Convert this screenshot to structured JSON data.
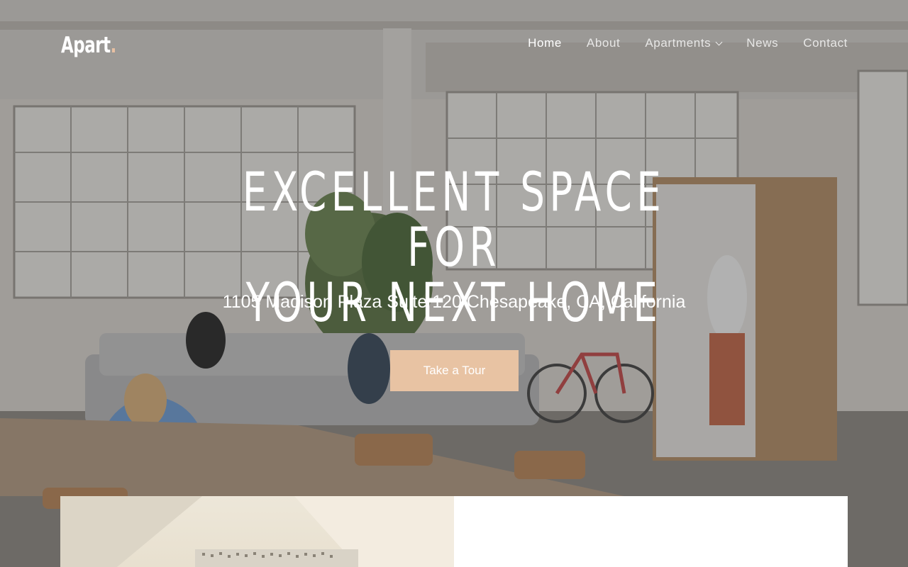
{
  "brand": {
    "name": "Apart",
    "dot": "."
  },
  "nav": {
    "items": [
      {
        "label": "Home",
        "active": true
      },
      {
        "label": "About"
      },
      {
        "label": "Apartments",
        "has_dropdown": true
      },
      {
        "label": "News"
      },
      {
        "label": "Contact"
      }
    ]
  },
  "hero": {
    "headline_line1": "EXCELLENT SPACE FOR",
    "headline_line2": "YOUR NEXT HOME",
    "address": "1105 Madison Plaza Suite 120 Chesapeake, CA, California",
    "cta_label": "Take a Tour"
  },
  "colors": {
    "accent": "#e8c3a3",
    "text": "#ffffff"
  },
  "icons": {
    "dropdown": "chevron-down-icon"
  }
}
